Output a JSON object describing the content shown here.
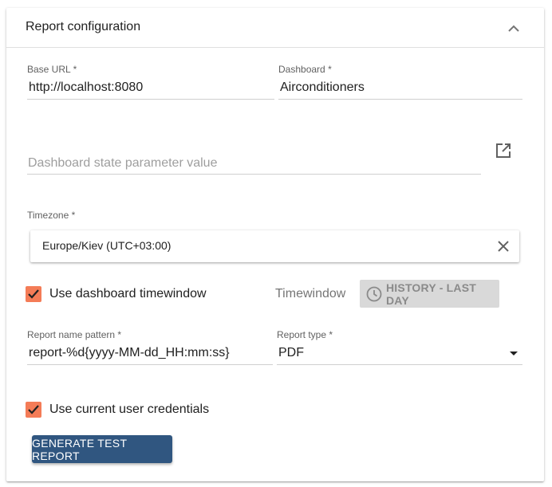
{
  "panel": {
    "title": "Report configuration"
  },
  "base_url": {
    "label": "Base URL",
    "required_mark": "*",
    "value": "http://localhost:8080"
  },
  "dashboard": {
    "label": "Dashboard",
    "required_mark": "*",
    "value": "Airconditioners"
  },
  "state_param": {
    "placeholder": "Dashboard state parameter value",
    "value": ""
  },
  "timezone": {
    "label": "Timezone",
    "required_mark": "*",
    "value": "Europe/Kiev (UTC+03:00)"
  },
  "use_dashboard_timewindow": {
    "label": "Use dashboard timewindow",
    "checked": true
  },
  "timewindow": {
    "label": "Timewindow",
    "button_label": "HISTORY - LAST DAY"
  },
  "report_name_pattern": {
    "label": "Report name pattern",
    "required_mark": "*",
    "value": "report-%d{yyyy-MM-dd_HH:mm:ss}"
  },
  "report_type": {
    "label": "Report type",
    "required_mark": "*",
    "value": "PDF"
  },
  "use_current_user_credentials": {
    "label": "Use current user credentials",
    "checked": true
  },
  "generate_button": {
    "label": "GENERATE TEST REPORT"
  },
  "icons": {
    "collapse": "chevron-up-icon",
    "open_external": "open-in-new-icon",
    "clear": "close-icon",
    "check": "check-icon",
    "clock": "clock-icon",
    "dropdown": "dropdown-arrow-icon"
  },
  "colors": {
    "checkbox_accent": "#f47c57",
    "primary_button": "#305680",
    "disabled_button": "#d9d9d9"
  }
}
